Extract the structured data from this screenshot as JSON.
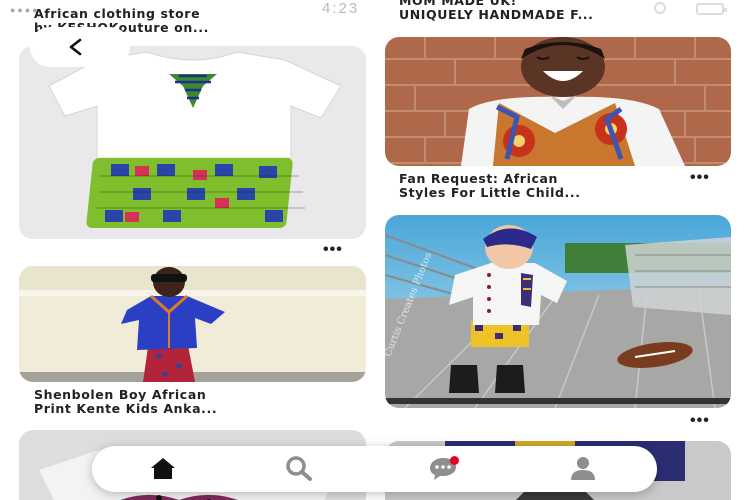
{
  "status_bar": {
    "time": "4:23"
  },
  "header": {
    "back_label": "<"
  },
  "pins": [
    {
      "title_line1": "African clothing store",
      "title_line2": "by KESHOKouture on..."
    },
    {
      "title_line1": "MOM MADE UK!",
      "title_line2": "UNIQUELY HANDMADE F..."
    },
    {
      "title_line1": "Fan Request: African",
      "title_line2": "Styles For Little Child..."
    },
    {
      "title_line1": "Shenbolen Boy African",
      "title_line2": "Print Kente Kids Anka..."
    }
  ],
  "more_options_label": "•••",
  "photo_watermark": "Curtis Creates Photos",
  "bottom_nav": {
    "items": [
      "home-icon",
      "search-icon",
      "messages-icon",
      "profile-icon"
    ],
    "active_color": "#111111",
    "inactive_color": "#8e8e8e",
    "notification_color": "#e60023"
  }
}
